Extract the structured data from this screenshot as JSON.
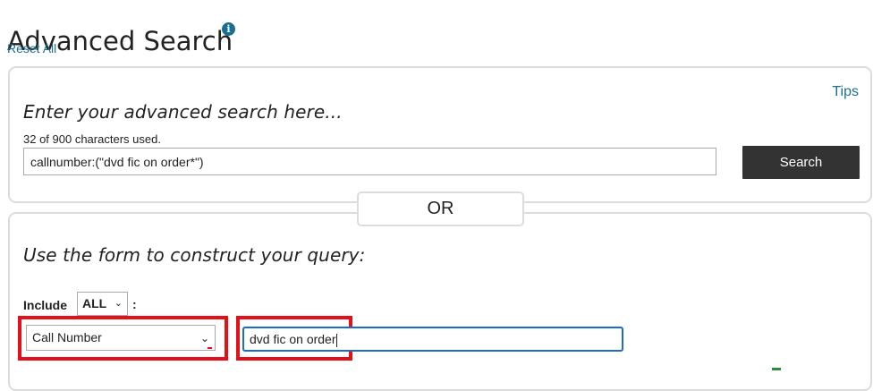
{
  "header": {
    "title": "Advanced Search",
    "reset_all": "Reset All",
    "info_icon": "info-circle-icon"
  },
  "freeform": {
    "tips": "Tips",
    "heading": "Enter your advanced search here...",
    "char_count": "32 of 900 characters used.",
    "query_value": "callnumber:(\"dvd fic on order*\")",
    "search_label": "Search"
  },
  "divider": {
    "or_label": "OR"
  },
  "form": {
    "heading": "Use the form to construct your query:",
    "include_label": "Include",
    "include_value": "ALL",
    "colon": ":",
    "field_value": "Call Number",
    "term_value": "dvd fic on order"
  },
  "colors": {
    "link": "#1a6e8f",
    "button_bg": "#333333",
    "highlight": "#e3101a",
    "focus_border": "#1a6ec9"
  }
}
